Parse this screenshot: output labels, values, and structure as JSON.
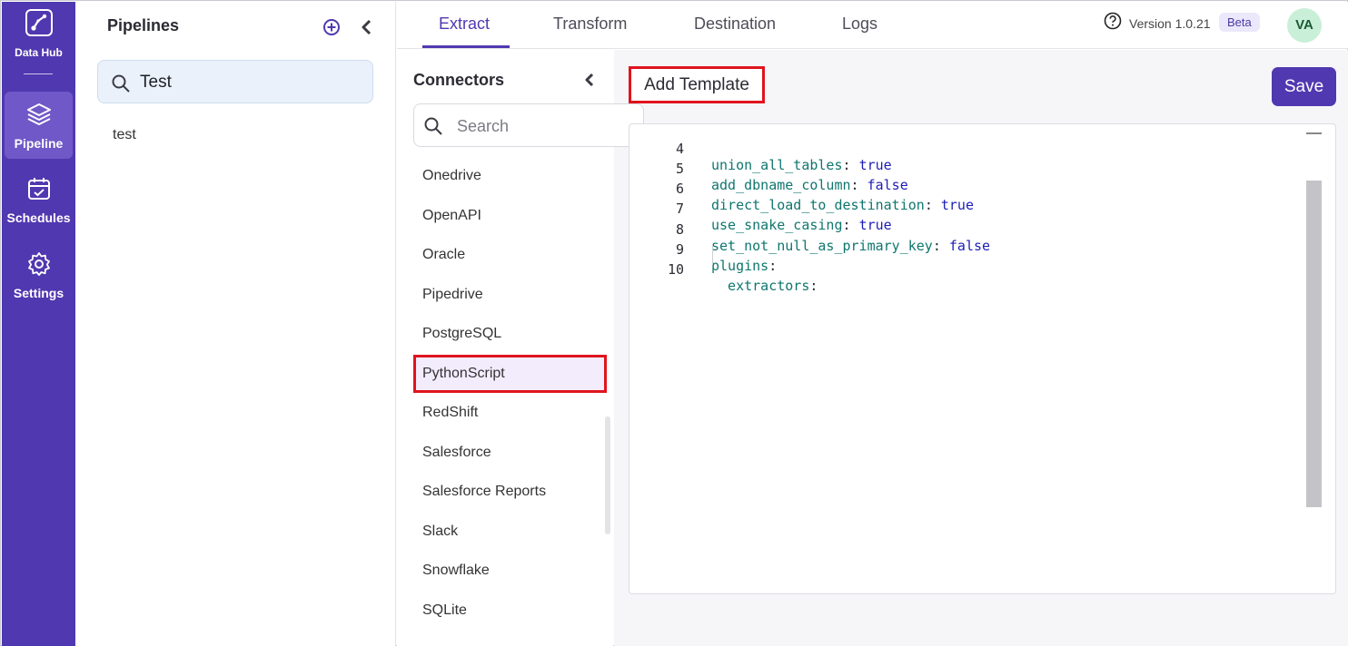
{
  "sidebar": {
    "logo_label": "Data Hub",
    "items": [
      {
        "label": "Pipeline",
        "icon": "layers-icon",
        "active": true
      },
      {
        "label": "Schedules",
        "icon": "calendar-check-icon",
        "active": false
      },
      {
        "label": "Settings",
        "icon": "gear-icon",
        "active": false
      }
    ]
  },
  "pipelines": {
    "title": "Pipelines",
    "search_value": "Test",
    "items": [
      "test"
    ]
  },
  "tabs": [
    {
      "label": "Extract",
      "active": true
    },
    {
      "label": "Transform",
      "active": false
    },
    {
      "label": "Destination",
      "active": false
    },
    {
      "label": "Logs",
      "active": false
    }
  ],
  "header": {
    "version": "Version 1.0.21",
    "badge": "Beta",
    "avatar_initials": "VA"
  },
  "connectors": {
    "title": "Connectors",
    "search_placeholder": "Search",
    "items": [
      "Onedrive",
      "OpenAPI",
      "Oracle",
      "Pipedrive",
      "PostgreSQL",
      "PythonScript",
      "RedShift",
      "Salesforce",
      "Salesforce Reports",
      "Slack",
      "Snowflake",
      "SQLite"
    ],
    "selected": "PythonScript"
  },
  "editor": {
    "add_template_label": "Add Template",
    "save_label": "Save",
    "lines": [
      {
        "n": "4",
        "key": "union_all_tables",
        "value": "true"
      },
      {
        "n": "5",
        "key": "add_dbname_column",
        "value": "false"
      },
      {
        "n": "6",
        "key": "direct_load_to_destination",
        "value": "true"
      },
      {
        "n": "7",
        "key": "use_snake_casing",
        "value": "true"
      },
      {
        "n": "8",
        "key": "set_not_null_as_primary_key",
        "value": "false"
      },
      {
        "n": "9",
        "key": "plugins",
        "value": ""
      },
      {
        "n": "10",
        "key": "  extractors",
        "value": ""
      }
    ]
  },
  "colors": {
    "brand": "#5038b0",
    "highlight_border": "#e0141e"
  }
}
